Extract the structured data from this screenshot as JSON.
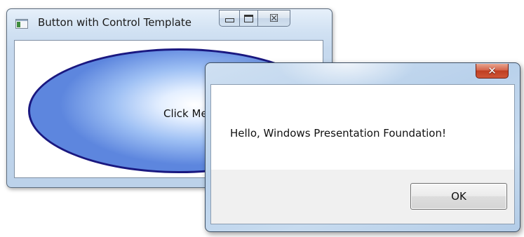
{
  "main_window": {
    "title": "Button with Control Template",
    "icon": "window-app-icon",
    "controls": {
      "minimize_icon": "minimize-icon",
      "maximize_icon": "maximize-icon",
      "close_glyph": "☒"
    },
    "button": {
      "label": "Click Me!"
    }
  },
  "message_box": {
    "close_glyph": "✕",
    "message": "Hello, Windows Presentation Foundation!",
    "ok_label": "OK"
  },
  "colors": {
    "ellipse_border": "#1a1880",
    "ellipse_fill": "#9ec0f4",
    "close_button": "#c9452a",
    "dialog_footer": "#f0f0f0"
  }
}
